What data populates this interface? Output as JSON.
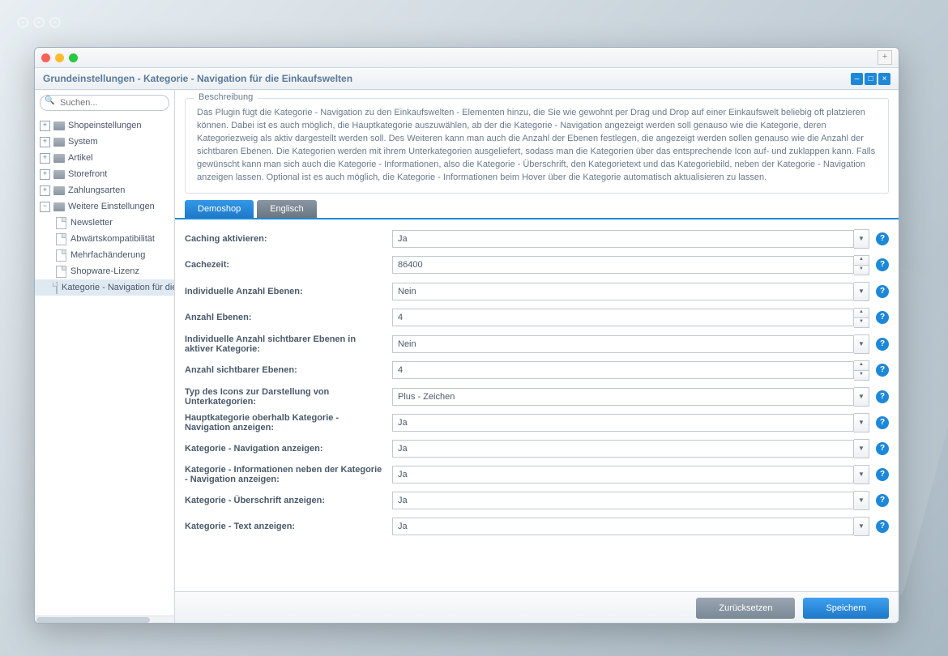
{
  "window": {
    "title": "Grundeinstellungen - Kategorie - Navigation für die Einkaufswelten"
  },
  "search": {
    "placeholder": "Suchen..."
  },
  "tree": {
    "top": [
      {
        "label": "Shopeinstellungen",
        "exp": "+"
      },
      {
        "label": "System",
        "exp": "+"
      },
      {
        "label": "Artikel",
        "exp": "+"
      },
      {
        "label": "Storefront",
        "exp": "+"
      },
      {
        "label": "Zahlungsarten",
        "exp": "+"
      },
      {
        "label": "Weitere Einstellungen",
        "exp": "−"
      }
    ],
    "children": [
      {
        "label": "Newsletter"
      },
      {
        "label": "Abwärtskompatibilität"
      },
      {
        "label": "Mehrfachänderung"
      },
      {
        "label": "Shopware-Lizenz"
      },
      {
        "label": "Kategorie - Navigation für die E",
        "selected": true
      }
    ]
  },
  "description": {
    "legend": "Beschreibung",
    "text": "Das Plugin fügt die Kategorie - Navigation zu den Einkaufswelten - Elementen hinzu, die Sie wie gewohnt per Drag und Drop auf einer Einkaufswelt beliebig oft platzieren können. Dabei ist es auch möglich, die Hauptkategorie auszuwählen, ab der die Kategorie - Navigation angezeigt werden soll genauso wie die Kategorie, deren Kategoriezweig als aktiv dargestellt werden soll. Des Weiteren kann man auch die Anzahl der Ebenen festlegen, die angezeigt werden sollen genauso wie die Anzahl der sichtbaren Ebenen. Die Kategorien werden mit ihrem Unterkategorien ausgeliefert, sodass man die Kategorien über das entsprechende Icon auf- und zuklappen kann. Falls gewünscht kann man sich auch die Kategorie - Informationen, also die Kategorie - Überschrift, den Kategorietext und das Kategoriebild, neben der Kategorie - Navigation anzeigen lassen. Optional ist es auch möglich, die Kategorie - Informationen beim Hover über die Kategorie automatisch aktualisieren zu lassen."
  },
  "tabs": {
    "0": "Demoshop",
    "1": "Englisch"
  },
  "form": [
    {
      "label": "Caching aktivieren:",
      "value": "Ja",
      "type": "select"
    },
    {
      "label": "Cachezeit:",
      "value": "86400",
      "type": "number"
    },
    {
      "label": "Individuelle Anzahl Ebenen:",
      "value": "Nein",
      "type": "select"
    },
    {
      "label": "Anzahl Ebenen:",
      "value": "4",
      "type": "number"
    },
    {
      "label": "Individuelle Anzahl sichtbarer Ebenen in aktiver Kategorie:",
      "value": "Nein",
      "type": "select"
    },
    {
      "label": "Anzahl sichtbarer Ebenen:",
      "value": "4",
      "type": "number"
    },
    {
      "label": "Typ des Icons zur Darstellung von Unterkategorien:",
      "value": "Plus - Zeichen",
      "type": "select"
    },
    {
      "label": "Hauptkategorie oberhalb Kategorie - Navigation anzeigen:",
      "value": "Ja",
      "type": "select"
    },
    {
      "label": "Kategorie - Navigation anzeigen:",
      "value": "Ja",
      "type": "select"
    },
    {
      "label": "Kategorie - Informationen neben der Kategorie - Navigation anzeigen:",
      "value": "Ja",
      "type": "select"
    },
    {
      "label": "Kategorie - Überschrift anzeigen:",
      "value": "Ja",
      "type": "select"
    },
    {
      "label": "Kategorie - Text anzeigen:",
      "value": "Ja",
      "type": "select"
    }
  ],
  "buttons": {
    "reset": "Zurücksetzen",
    "save": "Speichern"
  }
}
